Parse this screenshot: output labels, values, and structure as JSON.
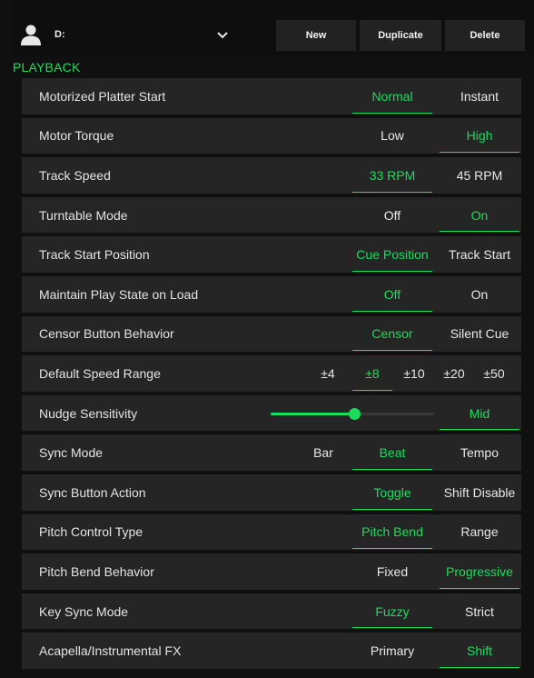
{
  "colors": {
    "accent": "#1ddc5c",
    "row_bg": "#252525",
    "page_bg": "#101010",
    "button_bg": "#222222"
  },
  "header": {
    "profile_icon": "user-icon",
    "profile_name": "D:",
    "dropdown_icon": "chevron-down-icon",
    "buttons": {
      "new": "New",
      "duplicate": "Duplicate",
      "delete": "Delete"
    }
  },
  "section": {
    "title": "PLAYBACK"
  },
  "settings": [
    {
      "label": "Motorized Platter Start",
      "options": [
        "Normal",
        "Instant"
      ],
      "selected": "Normal"
    },
    {
      "label": "Motor Torque",
      "options": [
        "Low",
        "High"
      ],
      "selected": "High"
    },
    {
      "label": "Track Speed",
      "options": [
        "33 RPM",
        "45 RPM"
      ],
      "selected": "33 RPM"
    },
    {
      "label": "Turntable Mode",
      "options": [
        "Off",
        "On"
      ],
      "selected": "On"
    },
    {
      "label": "Track Start Position",
      "options": [
        "Cue Position",
        "Track Start"
      ],
      "selected": "Cue Position"
    },
    {
      "label": "Maintain Play State on Load",
      "options": [
        "Off",
        "On"
      ],
      "selected": "Off"
    },
    {
      "label": "Censor Button Behavior",
      "options": [
        "Censor",
        "Silent Cue"
      ],
      "selected": "Censor"
    },
    {
      "label": "Default Speed Range",
      "options": [
        "±4",
        "±8",
        "±10",
        "±20",
        "±50"
      ],
      "selected": "±8"
    },
    {
      "label": "Nudge Sensitivity",
      "slider": {
        "value_fraction": 0.51,
        "value_label": "Mid"
      }
    },
    {
      "label": "Sync Mode",
      "options": [
        "Bar",
        "Beat",
        "Tempo"
      ],
      "selected": "Beat"
    },
    {
      "label": "Sync Button Action",
      "options": [
        "Toggle",
        "Shift Disable"
      ],
      "selected": "Toggle"
    },
    {
      "label": "Pitch Control Type",
      "options": [
        "Pitch Bend",
        "Range"
      ],
      "selected": "Pitch Bend"
    },
    {
      "label": "Pitch Bend Behavior",
      "options": [
        "Fixed",
        "Progressive"
      ],
      "selected": "Progressive"
    },
    {
      "label": "Key Sync Mode",
      "options": [
        "Fuzzy",
        "Strict"
      ],
      "selected": "Fuzzy"
    },
    {
      "label": "Acapella/Instrumental FX",
      "options": [
        "Primary",
        "Shift"
      ],
      "selected": "Shift"
    }
  ]
}
